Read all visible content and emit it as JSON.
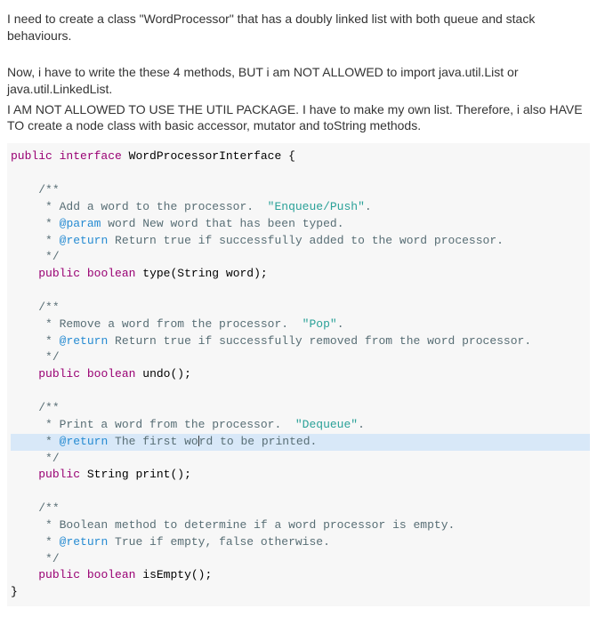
{
  "description": {
    "p1": "I need to create a class \"WordProcessor\" that has a doubly linked list with both queue and stack behaviours.",
    "p2": "Now, i have to write the these 4 methods, BUT i am NOT ALLOWED to import java.util.List or java.util.LinkedList.",
    "p3": "I AM NOT ALLOWED TO USE THE UTIL PACKAGE. I have to make my own list. Therefore, i also HAVE TO create a node class with basic accessor, mutator and toString methods."
  },
  "code": {
    "kw_public": "public",
    "kw_interface": "interface",
    "kw_boolean": "boolean",
    "iface_name": "WordProcessorInterface",
    "brace_open": "{",
    "brace_close": "}",
    "doc_open": "/**",
    "doc_close": " */",
    "star": " *",
    "m1": {
      "c1": " * Add a word to the processor.  ",
      "c1s": "\"Enqueue/Push\"",
      "c1e": ".",
      "p_tag": "@param",
      "p_text": " word New word that has been typed.",
      "r_tag": "@return",
      "r_text": " Return true if successfully added to the word processor.",
      "sig_name": "type",
      "sig_params": "(String word);"
    },
    "m2": {
      "c1": " * Remove a word from the processor.  ",
      "c1s": "\"Pop\"",
      "c1e": ".",
      "r_tag": "@return",
      "r_text": " Return true if successfully removed from the word processor.",
      "sig_name": "undo",
      "sig_params": "();"
    },
    "m3": {
      "c1": " * Print a word from the processor.  ",
      "c1s": "\"Dequeue\"",
      "c1e": ".",
      "r_tag": "@return",
      "r_text_a": " The first wo",
      "r_text_b": "rd to be printed.",
      "sig_type": "String",
      "sig_name": "print",
      "sig_params": "();"
    },
    "m4": {
      "c1": " * Boolean method to determine if a word processor is empty.",
      "r_tag": "@return",
      "r_text": " True if empty, false otherwise.",
      "sig_name": "isEmpty",
      "sig_params": "();"
    }
  }
}
